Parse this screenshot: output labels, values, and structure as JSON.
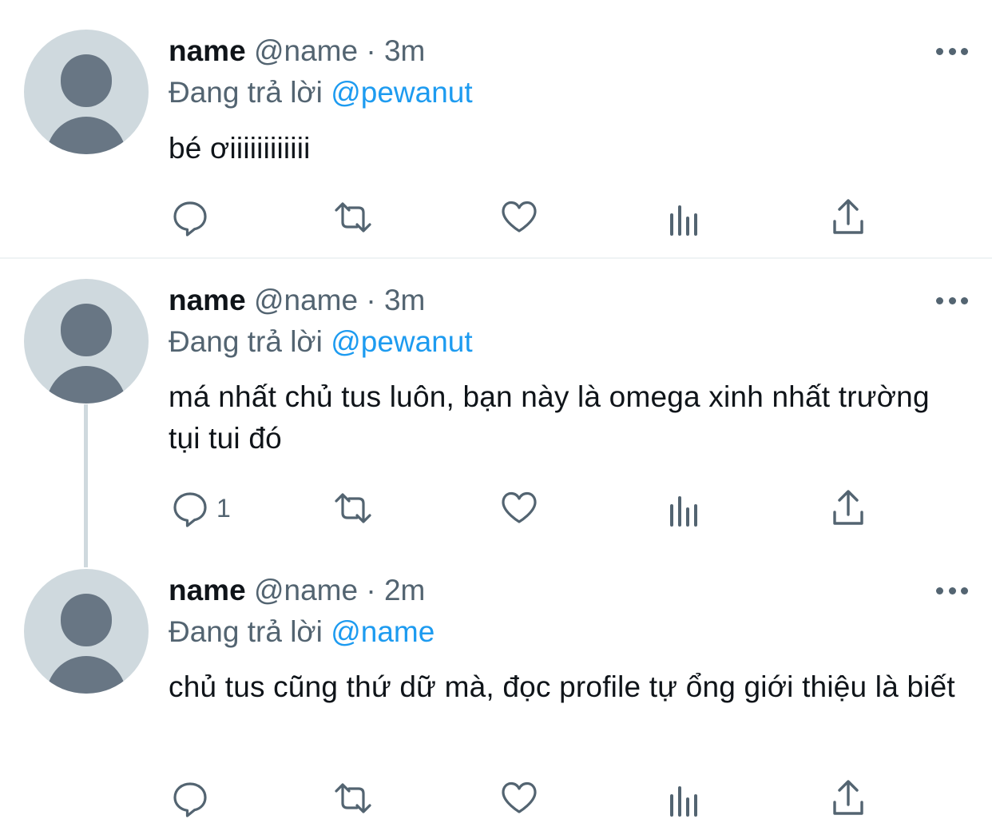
{
  "tweets": [
    {
      "name": "name",
      "handle": "@name",
      "separator": "·",
      "time": "3m",
      "replying_prefix": "Đang trả lời",
      "replying_to": "@pewanut",
      "text": "bé ơiiiiiiiiiiii",
      "reply_count": ""
    },
    {
      "name": "name",
      "handle": "@name",
      "separator": "·",
      "time": "3m",
      "replying_prefix": "Đang trả lời",
      "replying_to": "@pewanut",
      "text": "má nhất chủ tus luôn, bạn này là omega xinh nhất trường tụi tui đó",
      "reply_count": "1"
    },
    {
      "name": "name",
      "handle": "@name",
      "separator": "·",
      "time": "2m",
      "replying_prefix": "Đang trả lời",
      "replying_to": "@name",
      "text": "chủ tus cũng thứ dữ mà, đọc profile tự ổng giới thiệu là biết",
      "reply_count": ""
    }
  ],
  "icons": {
    "reply": "reply-icon",
    "retweet": "retweet-icon",
    "like": "heart-icon",
    "analytics": "analytics-icon",
    "share": "share-icon",
    "more": "more-icon"
  },
  "colors": {
    "text": "#0f1419",
    "secondary": "#536471",
    "mention": "#1d9bf0",
    "avatar_bg": "#cfd9de",
    "avatar_fg": "#687684"
  }
}
